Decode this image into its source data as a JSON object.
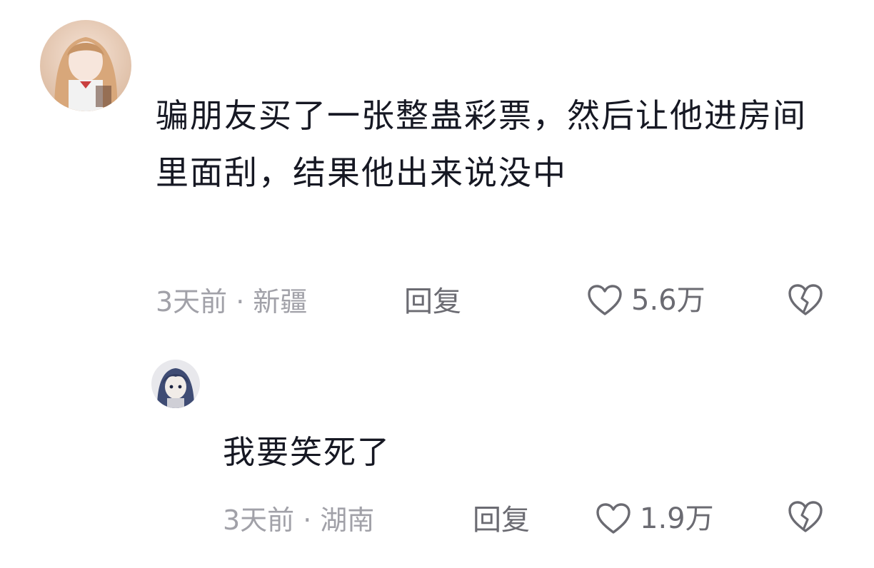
{
  "comment": {
    "avatar_icon": "user-avatar-icon",
    "text": "骗朋友买了一张整蛊彩票，然后让他进房间里面刮，结果他出来说没中",
    "time": "3天前",
    "location": "新疆",
    "reply_label": "回复",
    "likes": "5.6万"
  },
  "reply": {
    "avatar_icon": "user-avatar-icon",
    "text": "我要笑死了",
    "time": "3天前",
    "location": "湖南",
    "reply_label": "回复",
    "likes": "1.9万"
  },
  "separator": "·",
  "icons": {
    "like": "heart-outline-icon",
    "dislike": "broken-heart-icon"
  },
  "colors": {
    "text": "#161823",
    "meta": "#a1a1a8",
    "action": "#6b6b72"
  }
}
